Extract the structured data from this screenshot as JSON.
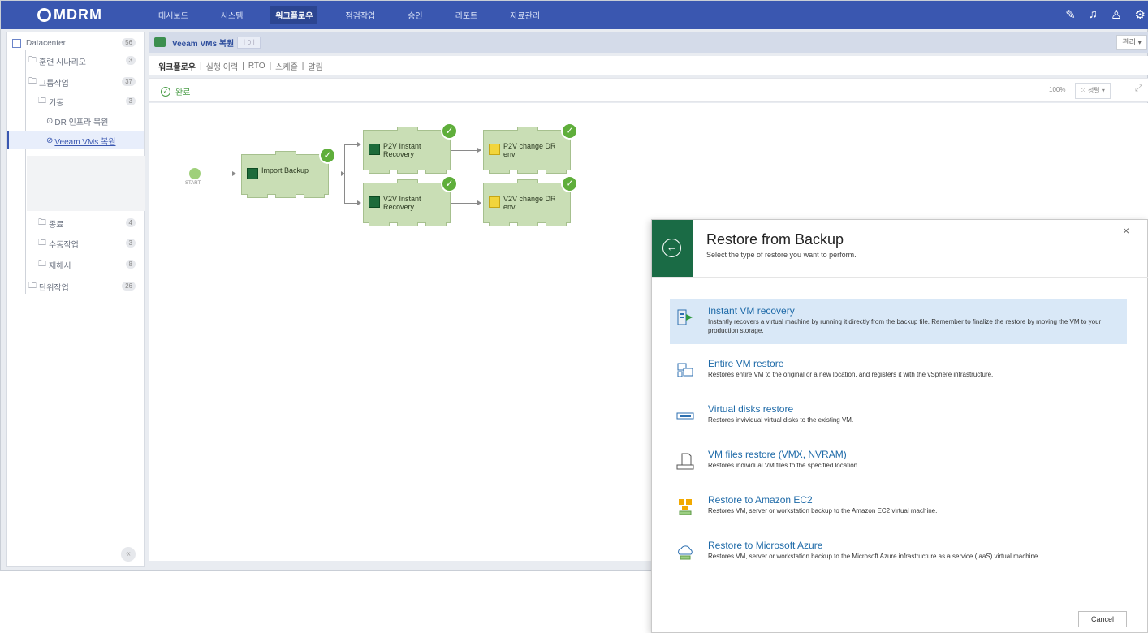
{
  "app": {
    "logo": "MDRM",
    "nav": [
      "대시보드",
      "시스템",
      "워크플로우",
      "점검작업",
      "승인",
      "리포트",
      "자료관리"
    ],
    "active_nav_index": 2,
    "icons": [
      "edit-icon",
      "bell-icon",
      "user-icon",
      "settings-icon"
    ]
  },
  "sidebar": {
    "root": {
      "label": "Datacenter",
      "count": "56"
    },
    "items": [
      {
        "label": "훈련 시나리오",
        "count": "3"
      },
      {
        "label": "그룹작업",
        "count": "37"
      },
      {
        "label": "기동",
        "count": "3"
      },
      {
        "label": "DR 인프라 복원",
        "count": ""
      },
      {
        "label": "Veeam VMs 복원",
        "count": ""
      },
      {
        "label": "종료",
        "count": "4"
      },
      {
        "label": "수동작업",
        "count": "3"
      },
      {
        "label": "재해시",
        "count": "8"
      },
      {
        "label": "단위작업",
        "count": "26"
      }
    ],
    "collapse_icon": "«"
  },
  "header": {
    "title": "Veeam VMs 복원",
    "badge": "ㅣ0ㅣ",
    "manage_label": "관리"
  },
  "subtabs": [
    "워크플로우",
    "실행 이력",
    "RTO",
    "스케줄",
    "알림"
  ],
  "status": {
    "label": "완료",
    "zoom": "100%",
    "sort_label": "정렬"
  },
  "workflow": {
    "start_label": "START",
    "nodes": [
      {
        "id": "import",
        "label": "Import Backup"
      },
      {
        "id": "p2v-recovery",
        "label": "P2V Instant Recovery"
      },
      {
        "id": "p2v-change",
        "label": "P2V change DR env"
      },
      {
        "id": "v2v-recovery",
        "label": "V2V Instant Recovery"
      },
      {
        "id": "v2v-change",
        "label": "V2V change DR env"
      }
    ]
  },
  "dialog": {
    "title": "Restore from Backup",
    "subtitle": "Select the type of restore you want to perform.",
    "close": "×",
    "options": [
      {
        "title": "Instant VM recovery",
        "desc": "Instantly recovers a virtual machine by running it directly from the backup file. Remember to finalize the restore by moving the VM to your production storage."
      },
      {
        "title": "Entire VM restore",
        "desc": "Restores entire VM to the original or a new location, and registers it with the vSphere infrastructure."
      },
      {
        "title": "Virtual disks restore",
        "desc": "Restores invividual virtual disks to the existing VM."
      },
      {
        "title": "VM files restore (VMX, NVRAM)",
        "desc": "Restores individual VM files to the specified location."
      },
      {
        "title": "Restore to Amazon EC2",
        "desc": "Restores VM, server or workstation backup to the Amazon EC2 virtual machine."
      },
      {
        "title": "Restore to Microsoft Azure",
        "desc": "Restores VM, server or workstation backup to the Microsoft Azure infrastructure as a service (IaaS) virtual machine."
      }
    ],
    "cancel_label": "Cancel",
    "accent": "#1a6b45"
  }
}
